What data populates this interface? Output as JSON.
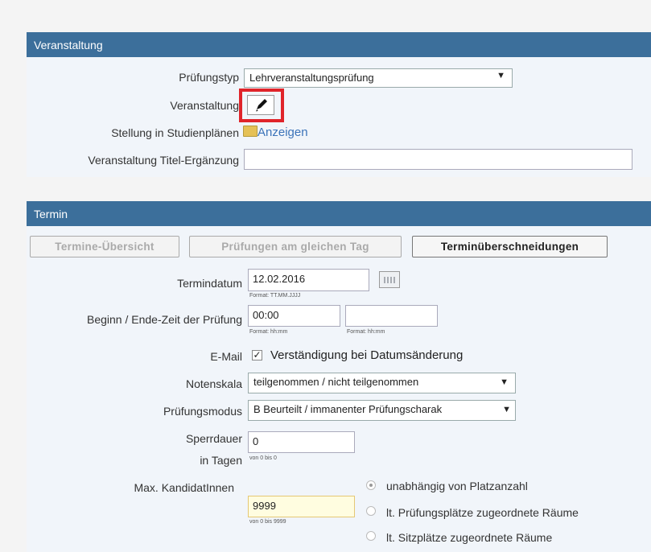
{
  "veranstaltung": {
    "header": "Veranstaltung",
    "pruefungstyp": {
      "label": "Prüfungstyp",
      "value": "Lehrveranstaltungsprüfung"
    },
    "veranstaltung_label": "Veranstaltung",
    "stellung": {
      "label": "Stellung in Studienplänen",
      "link": "Anzeigen"
    },
    "titel": {
      "label": "Veranstaltung Titel-Ergänzung",
      "value": ""
    }
  },
  "termin": {
    "header": "Termin",
    "buttons": {
      "uebersicht": "Termine-Übersicht",
      "gleicher_tag": "Prüfungen am gleichen Tag",
      "ueberschneidungen": "Terminüberschneidungen"
    },
    "termindatum": {
      "label": "Termindatum",
      "value": "12.02.2016",
      "format": "Format: TT.MM.JJJJ"
    },
    "zeit": {
      "label": "Beginn / Ende-Zeit der Prüfung",
      "begin": "00:00",
      "end": "",
      "format_begin": "Format: hh:mm",
      "format_end": "Format: hh:mm"
    },
    "email": {
      "label": "E-Mail",
      "checkbox_label": "Verständigung bei Datumsänderung",
      "checked": true
    },
    "notenskala": {
      "label": "Notenskala",
      "value": "teilgenommen / nicht teilgenommen"
    },
    "modus": {
      "label": "Prüfungsmodus",
      "value": "B Beurteilt / immanenter Prüfungscharak"
    },
    "sperrdauer": {
      "label": "Sperrdauer",
      "label2": "in Tagen",
      "value": "0",
      "range": "von 0 bis 0"
    },
    "kandidaten": {
      "label": "Max. KandidatInnen",
      "value": "9999",
      "range": "von 0 bis 9999",
      "options": [
        "unabhängig von Platzanzahl",
        "lt. Prüfungsplätze zugeordnete Räume",
        "lt. Sitzplätze zugeordnete Räume"
      ],
      "selected": 0
    }
  },
  "colors": {
    "header": "#3c6f9b",
    "highlight": "#e0242a",
    "link": "#3b73b9"
  }
}
